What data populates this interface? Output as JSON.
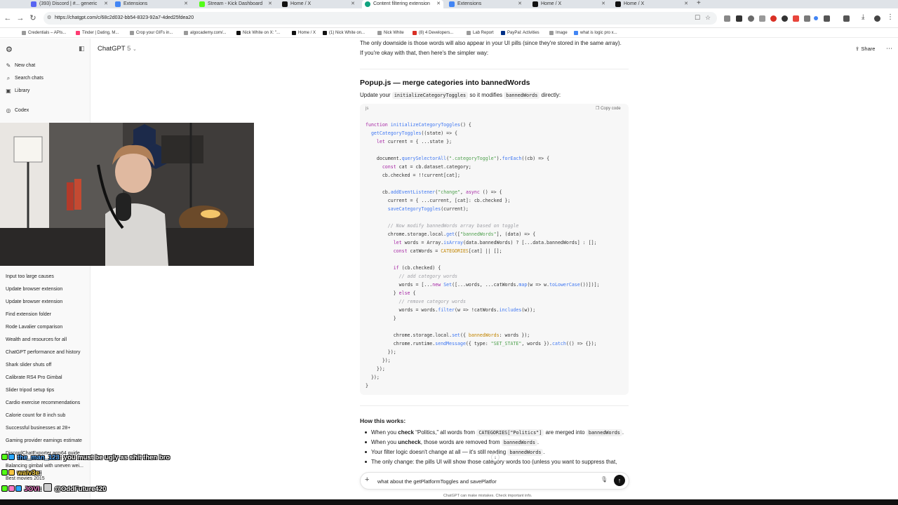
{
  "browser": {
    "tabs": [
      {
        "label": "(393) Discord | #... generic",
        "color": "#5865f2",
        "active": false
      },
      {
        "label": "Extensions",
        "color": "#4285f4",
        "active": false
      },
      {
        "label": "Stream - Kick Dashboard",
        "color": "#53fc18",
        "active": false
      },
      {
        "label": "Home / X",
        "color": "#111111",
        "active": false
      },
      {
        "label": "Content filtering extension",
        "color": "#10a37f",
        "active": true
      },
      {
        "label": "Extensions",
        "color": "#4285f4",
        "active": false
      },
      {
        "label": "Home / X",
        "color": "#111111",
        "active": false
      },
      {
        "label": "Home / X",
        "color": "#111111",
        "active": false
      }
    ],
    "url": "https://chatgpt.com/c/68c2d032-bb54-8323-92a7-4ded25fdea20",
    "bookmarks": [
      "Credentials – APIs...",
      "Tinder | Dating, M...",
      "Crop your GIFs in...",
      "algocademy.com/...",
      "Nick White on X: \"...",
      "Home / X",
      "(1) Nick White on...",
      "Nick White",
      "(8) 4 Developers...",
      "Lab Report",
      "PayPal: Activities",
      "Image",
      "what is logic pro x..."
    ]
  },
  "sidebar": {
    "nav": [
      {
        "label": "New chat",
        "icon": "new-chat-icon",
        "glyph": "✎"
      },
      {
        "label": "Search chats",
        "icon": "search-icon",
        "glyph": "⌕"
      },
      {
        "label": "Library",
        "icon": "library-icon",
        "glyph": "▣"
      },
      {
        "label": "Codex",
        "icon": "codex-icon",
        "glyph": "◎"
      }
    ],
    "chats": [
      "Input too large causes",
      "Update browser extension",
      "Update browser extension",
      "Find extension folder",
      "Rode Lavalier comparison",
      "Wealth and resources for all",
      "ChatGPT performance and history",
      "Shark slider shuts off",
      "Calibrate RS4 Pro Gimbal",
      "Slider tripod setup tips",
      "Cardio exercise recommendations",
      "Calorie count for 8 inch sub",
      "Successful businesses at 28+",
      "Gaming provider earnings estimate",
      "DiscordChatExporter arm64 guide",
      "Balancing gimbal with uneven wei...",
      "Best movies 2015"
    ]
  },
  "header": {
    "model": "ChatGPT",
    "version": "5",
    "share": "Share"
  },
  "content": {
    "intro_line1": "The only downside is those words will also appear in your UI pills (since they're stored in the same array).",
    "intro_line2": "If you're okay with that, then here's the simpler way:",
    "heading": "Popup.js — merge categories into bannedWords",
    "update_prefix": "Update your",
    "update_code1": "initializeCategoryToggles",
    "update_middle": "so it modifies",
    "update_code2": "bannedWords",
    "update_suffix": "directly:",
    "code_lang": "js",
    "copy_label": "Copy code",
    "how_heading": "How this works:",
    "bullets": {
      "b1_pre": "When you",
      "b1_bold": "check",
      "b1_mid": "“Politics,” all words from",
      "b1_code": "CATEGORIES[\"Politics\"]",
      "b1_post": "are merged into",
      "b1_code2": "bannedWords",
      "b1_end": ".",
      "b2_pre": "When you",
      "b2_bold": "uncheck",
      "b2_mid": ", those words are removed from",
      "b2_code": "bannedWords",
      "b2_end": ".",
      "b3_text": "Your filter logic doesn't change at all — it's still reading",
      "b3_code": "bannedWords",
      "b3_end": ".",
      "b4_text": "The only change: the pills UI will show those category words too (unless you want to suppress that,"
    }
  },
  "composer": {
    "value": "what about the getPlatformToggles and savePlatfor",
    "disclaimer": "ChatGPT can make mistakes. Check important info."
  },
  "stream_chat": [
    {
      "user": "the_man_123",
      "message": "you must be ugly as shit then bro"
    },
    {
      "user": "waiv3e",
      "message": ""
    },
    {
      "user": "JOVI",
      "message": "@OddFuture420"
    }
  ]
}
